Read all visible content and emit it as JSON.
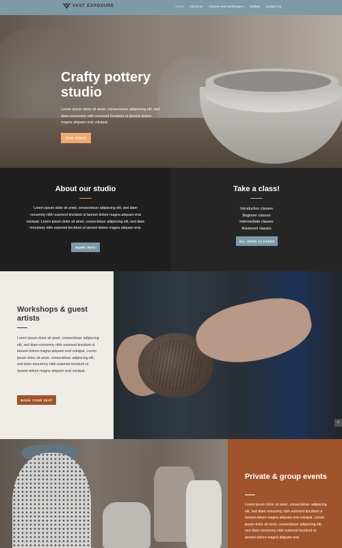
{
  "nav": {
    "logo_text": "VAST EXPOSURE",
    "items": [
      {
        "label": "Home",
        "active": true
      },
      {
        "label": "About us"
      },
      {
        "label": "Classes and workshops",
        "caret": "▾"
      },
      {
        "label": "Gallery"
      },
      {
        "label": "Contact us"
      }
    ]
  },
  "hero": {
    "title_line1": "Crafty pottery",
    "title_line2": "studio",
    "text": "Lorem ipsum dolor sit amet, consectetuer adipiscing elit, sed diam nonummy nibh euismod tincidunt ut laoreet dolore magna aliquam erat volutpat.",
    "button": "JOIN TODAY"
  },
  "about": {
    "title": "About our studio",
    "text": "Lorem ipsum dolor sit amet, consectetuer adipiscing elit, sed diam nonummy nibh euismod tincidunt ut laoreet dolore magna aliquam erat volutpat. Lorem ipsum dolor sit amet, consectetuer adipiscing elit, sed diam nonummy nibh euismod tincidunt ut laoreet dolore magna aliquam erat.",
    "button": "MORE INFO"
  },
  "classes": {
    "title": "Take a class!",
    "items": [
      "Introduction classes",
      "Beginner classes",
      "Intermediate classes",
      "Advanced classes"
    ],
    "button": "ALL OPEN CLASSES"
  },
  "workshops": {
    "title": "Workshops & guest artists",
    "text": "Lorem ipsum dolor sit amet, consectetuer adipiscing elit, sed diam nonummy nibh euismod tincidunt ut laoreet dolore magna aliquam erat volutpat. Lorem ipsum dolor sit amet, consectetuer adipiscing elit, sed diam nonummy nibh euismod tincidunt ut laoreet dolore magna aliquam erat volutpat.",
    "button": "BOOK YOUR SEAT"
  },
  "private": {
    "title": "Private & group events",
    "text": "Lorem ipsum dolor sit amet, consectetuer adipiscing elit, sed diam nonummy nibh euismod tincidunt ut laoreet dolore magna aliquam erat volutpat. Lorem ipsum dolor sit amet, consectetuer adipiscing elit, sed diam nonummy nibh euismod tincidunt ut laoreet dolore magna aliquam erat"
  },
  "scroll_top_icon": "^",
  "colors": {
    "nav": "#7f9aa7",
    "accent_orange": "#efab74",
    "rust": "#a1542c",
    "dark": "#1f1f1f",
    "light_panel": "#efece8"
  }
}
